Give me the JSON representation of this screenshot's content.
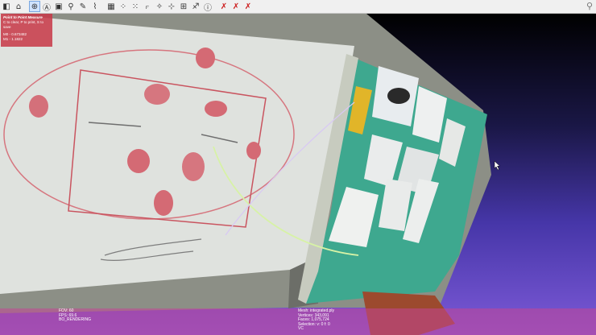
{
  "toolbar": {
    "icons": [
      "open-icon",
      "save-icon",
      "trackball-icon",
      "text-a-icon",
      "snapshot-icon",
      "light-icon",
      "bookmark-icon",
      "brush-icon",
      "select-faces-icon",
      "select-vertices-icon",
      "select-connected-icon",
      "measure-icon",
      "pickpoints-icon",
      "info-icon",
      "delete-faces-icon",
      "delete-vertices-icon",
      "delete-vfaces-icon"
    ],
    "colors": {
      "bar": "#f0f0f0",
      "red_actions": "#cc1f1f"
    }
  },
  "measure_panel": {
    "title": "Point to Point Measure",
    "instruction": "C to clear, P to print, S to save",
    "m0": "M0 - 0.673482",
    "m1": "M1 - 1.1822"
  },
  "status": {
    "fov": "FOV: 60",
    "fps": "FPS:   69.6",
    "rendering": "BO_RENDERING",
    "mesh": "Mesh: integrated.ply",
    "vertices": "Vertices: 343,091",
    "faces": "Faces: 1,075,724",
    "selection": "Selection: v: 0 f: 0",
    "vc": "VC"
  }
}
